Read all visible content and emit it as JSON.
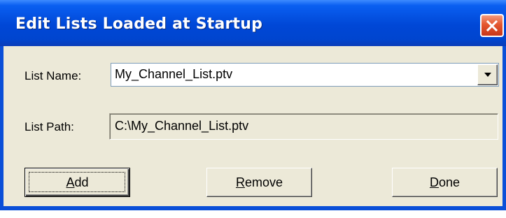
{
  "window": {
    "title": "Edit Lists Loaded at Startup",
    "close_icon": "close-icon",
    "colors": {
      "titlebar": "#0047d6",
      "face": "#ece9d8",
      "close": "#e4572f"
    }
  },
  "list_name": {
    "label": "List Name:",
    "value": "My_Channel_List.ptv",
    "dropdown_icon": "chevron-down-icon"
  },
  "list_path": {
    "label": "List Path:",
    "value": "C:\\My_Channel_List.ptv"
  },
  "buttons": {
    "add": {
      "mnemonic": "A",
      "rest": "dd"
    },
    "remove": {
      "mnemonic": "R",
      "rest": "emove"
    },
    "done": {
      "mnemonic": "D",
      "rest": "one"
    }
  }
}
